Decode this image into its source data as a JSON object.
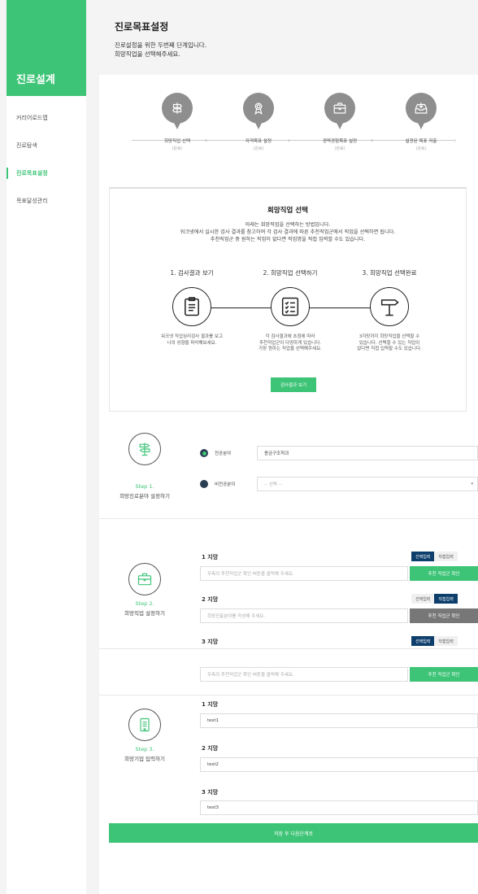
{
  "sidebar": {
    "title": "진로설계",
    "items": [
      {
        "label": "커리어로드맵",
        "active": false
      },
      {
        "label": "진로탐색",
        "active": false
      },
      {
        "label": "진로목표설정",
        "active": true
      },
      {
        "label": "목표달성관리",
        "active": false
      }
    ]
  },
  "header": {
    "title": "진로목표설정",
    "line1": "진로설정을 위한 두번째 단계입니다.",
    "line2": "희망직업을 선택해주세요."
  },
  "steps": [
    {
      "title": "희망직업 선택",
      "status": "(완료)",
      "icon": "signpost-icon"
    },
    {
      "title": "자격목표 설정",
      "status": "(완료)",
      "icon": "award-icon"
    },
    {
      "title": "경력경험목표 설정",
      "status": "(완료)",
      "icon": "briefcase-icon"
    },
    {
      "title": "설정된 목표 저출",
      "status": "(완료)",
      "icon": "inbox-download-icon"
    }
  ],
  "info": {
    "title": "희망직업 선택",
    "desc1": "아래는 희망직업을 선택하는 방법입니다.",
    "desc2": "워크넷에서 실시한 검사 결과를 참고하여 각 검사 결과에 따른 추천직업군에서 직업을 선택하면 됩니다.",
    "desc3": "추천직업군 중 원하는 직업이 없다면 직업명을 직접 입력할 수도 있습니다.",
    "phases": [
      {
        "title": "1. 검사결과 보기",
        "d1": "워크넷 직업심리검사 결과를 보고",
        "d2": "나의 성향을 파악해보세요.",
        "d3": "",
        "icon": "clipboard-icon"
      },
      {
        "title": "2. 희망직업 선택하기",
        "d1": "각 검사결과에 초점에 따라",
        "d2": "추천직업군이 다양하게 있습니다.",
        "d3": "가장 원하는 직업을 선택해주세요.",
        "icon": "checklist-icon"
      },
      {
        "title": "3. 희망직업 선택완료",
        "d1": "3지망까지 희망직업을 선택할 수",
        "d2": "있습니다. 선택할 수 있는 직업이",
        "d3": "없다면 직접 입력할 수도 있습니다.",
        "icon": "signpost-icon"
      }
    ],
    "button": "검사결과 보기"
  },
  "step1": {
    "step": "Step 1.",
    "label": "희망진로분야 설정하기",
    "opt1_label": "전공분야",
    "opt1_value": "용금구조학과",
    "opt2_label": "비전공분야",
    "opt2_value": "-- 선택 --"
  },
  "step2": {
    "step": "Step 2.",
    "label": "희망직업 설정하기",
    "wishes": [
      {
        "title": "1 지망",
        "placeholder": "우측의 추천직업군 확인 버튼을 클릭해 주세요.",
        "tog1": "선택입력",
        "tog2": "직접입력",
        "active": 1,
        "action": "추천 직업군 확인",
        "action_enabled": true
      },
      {
        "title": "2 지망",
        "placeholder": "희망진출분야를 작성해 주세요.",
        "tog1": "선택입력",
        "tog2": "직접입력",
        "active": 2,
        "action": "추천 직업군 확인",
        "action_enabled": false
      },
      {
        "title": "3 지망",
        "placeholder": "우측의 추천직업군 확인 버튼을 클릭해 주세요.",
        "tog1": "선택입력",
        "tog2": "직접입력",
        "active": 1,
        "action": "추천 직업군 확인",
        "action_enabled": true
      }
    ]
  },
  "step3": {
    "step": "Step 3.",
    "label": "희망기업 입력하기",
    "wishes": [
      {
        "title": "1 지망",
        "value": "test1"
      },
      {
        "title": "2 지망",
        "value": "test2"
      },
      {
        "title": "3 지망",
        "value": "test3"
      }
    ]
  },
  "save_button": "저장 후 다음단계로",
  "colors": {
    "accent": "#3dc476",
    "navy": "#0e3f6c",
    "gray": "#8e8e8e"
  }
}
